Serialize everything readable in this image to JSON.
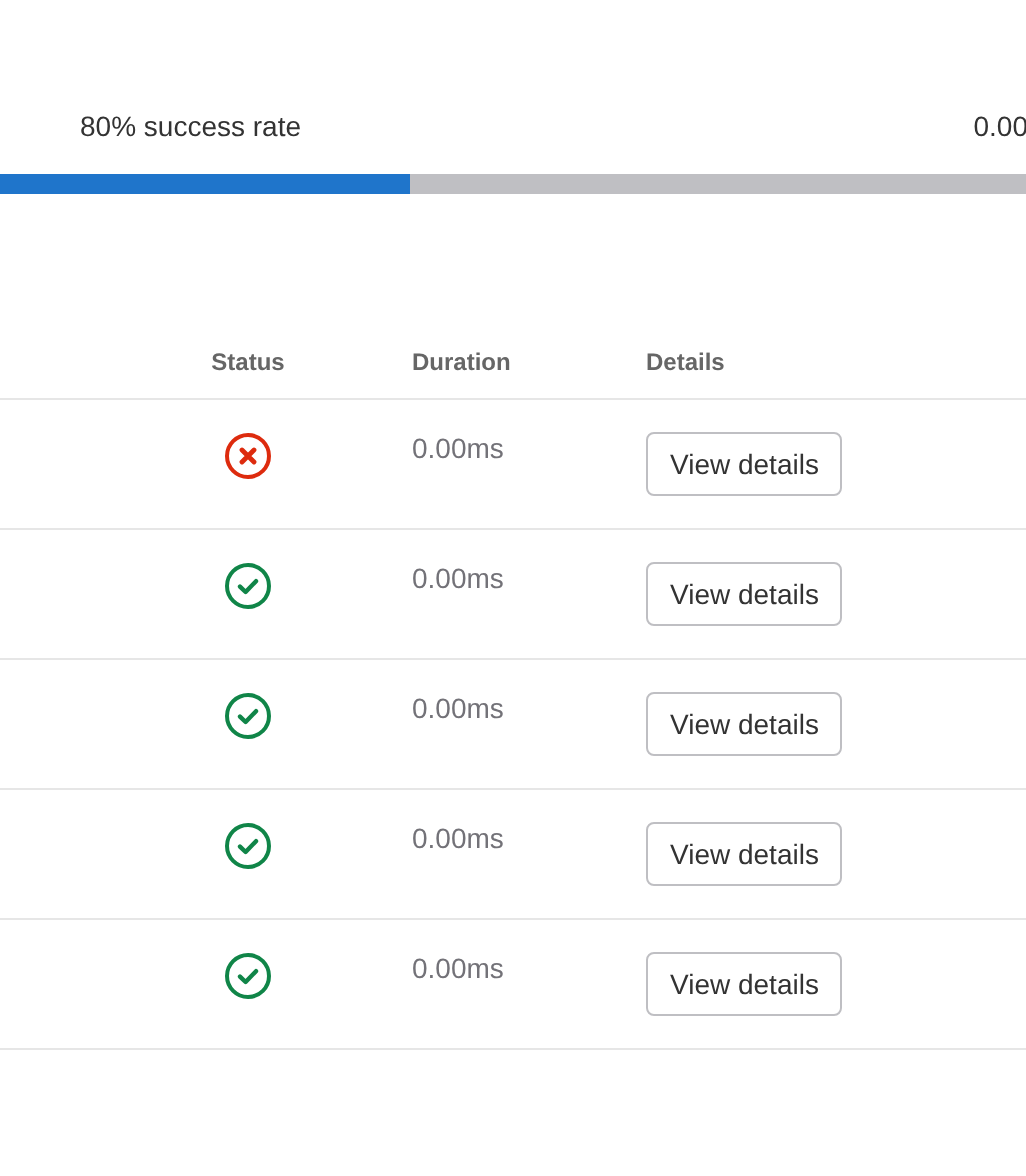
{
  "summary": {
    "label": "80% success rate",
    "value": "0.00",
    "level": 0.4
  },
  "table": {
    "columns": [
      "Status",
      "Duration",
      "Details"
    ],
    "rows": [
      {
        "kind": "failed",
        "duration": "0.00ms",
        "action": "View details"
      },
      {
        "kind": "passed",
        "duration": "0.00ms",
        "action": "View details"
      },
      {
        "kind": "passed",
        "duration": "0.00ms",
        "action": "View details"
      },
      {
        "kind": "passed",
        "duration": "0.00ms",
        "action": "View details"
      },
      {
        "kind": "passed",
        "duration": "0.00ms",
        "action": "View details"
      }
    ]
  }
}
